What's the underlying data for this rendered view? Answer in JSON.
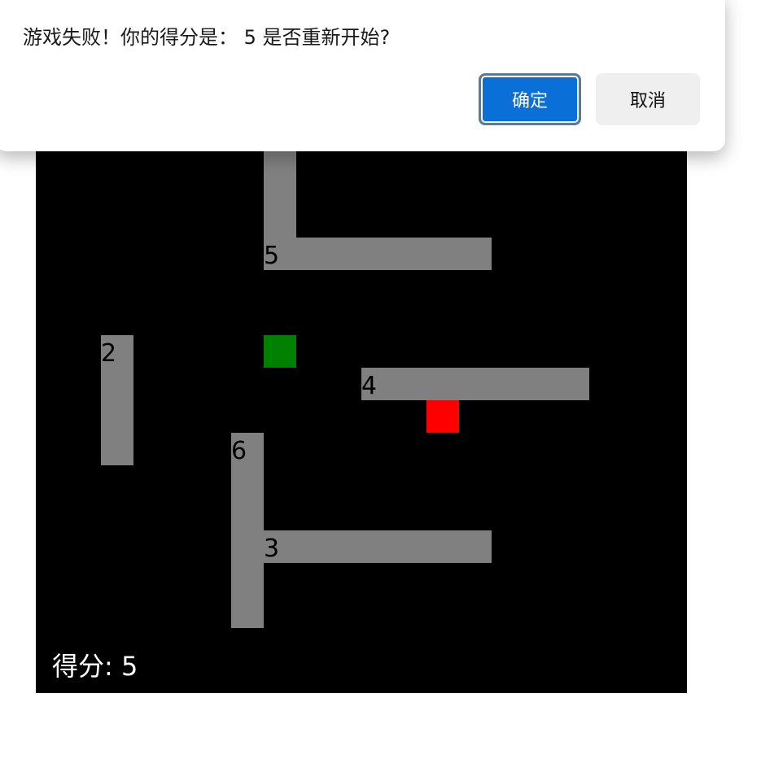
{
  "dialog": {
    "message": "游戏失败！你的得分是： 5 是否重新开始?",
    "ok_label": "确定",
    "cancel_label": "取消"
  },
  "game": {
    "score_text": "得分: 5",
    "colors": {
      "background": "#000000",
      "wall": "#808080",
      "player": "#008000",
      "enemy": "#ff0000",
      "score": "#ffffff"
    },
    "walls": [
      {
        "label": "5"
      },
      {
        "label": "2"
      },
      {
        "label": "4"
      },
      {
        "label": "6"
      },
      {
        "label": "3"
      }
    ]
  }
}
